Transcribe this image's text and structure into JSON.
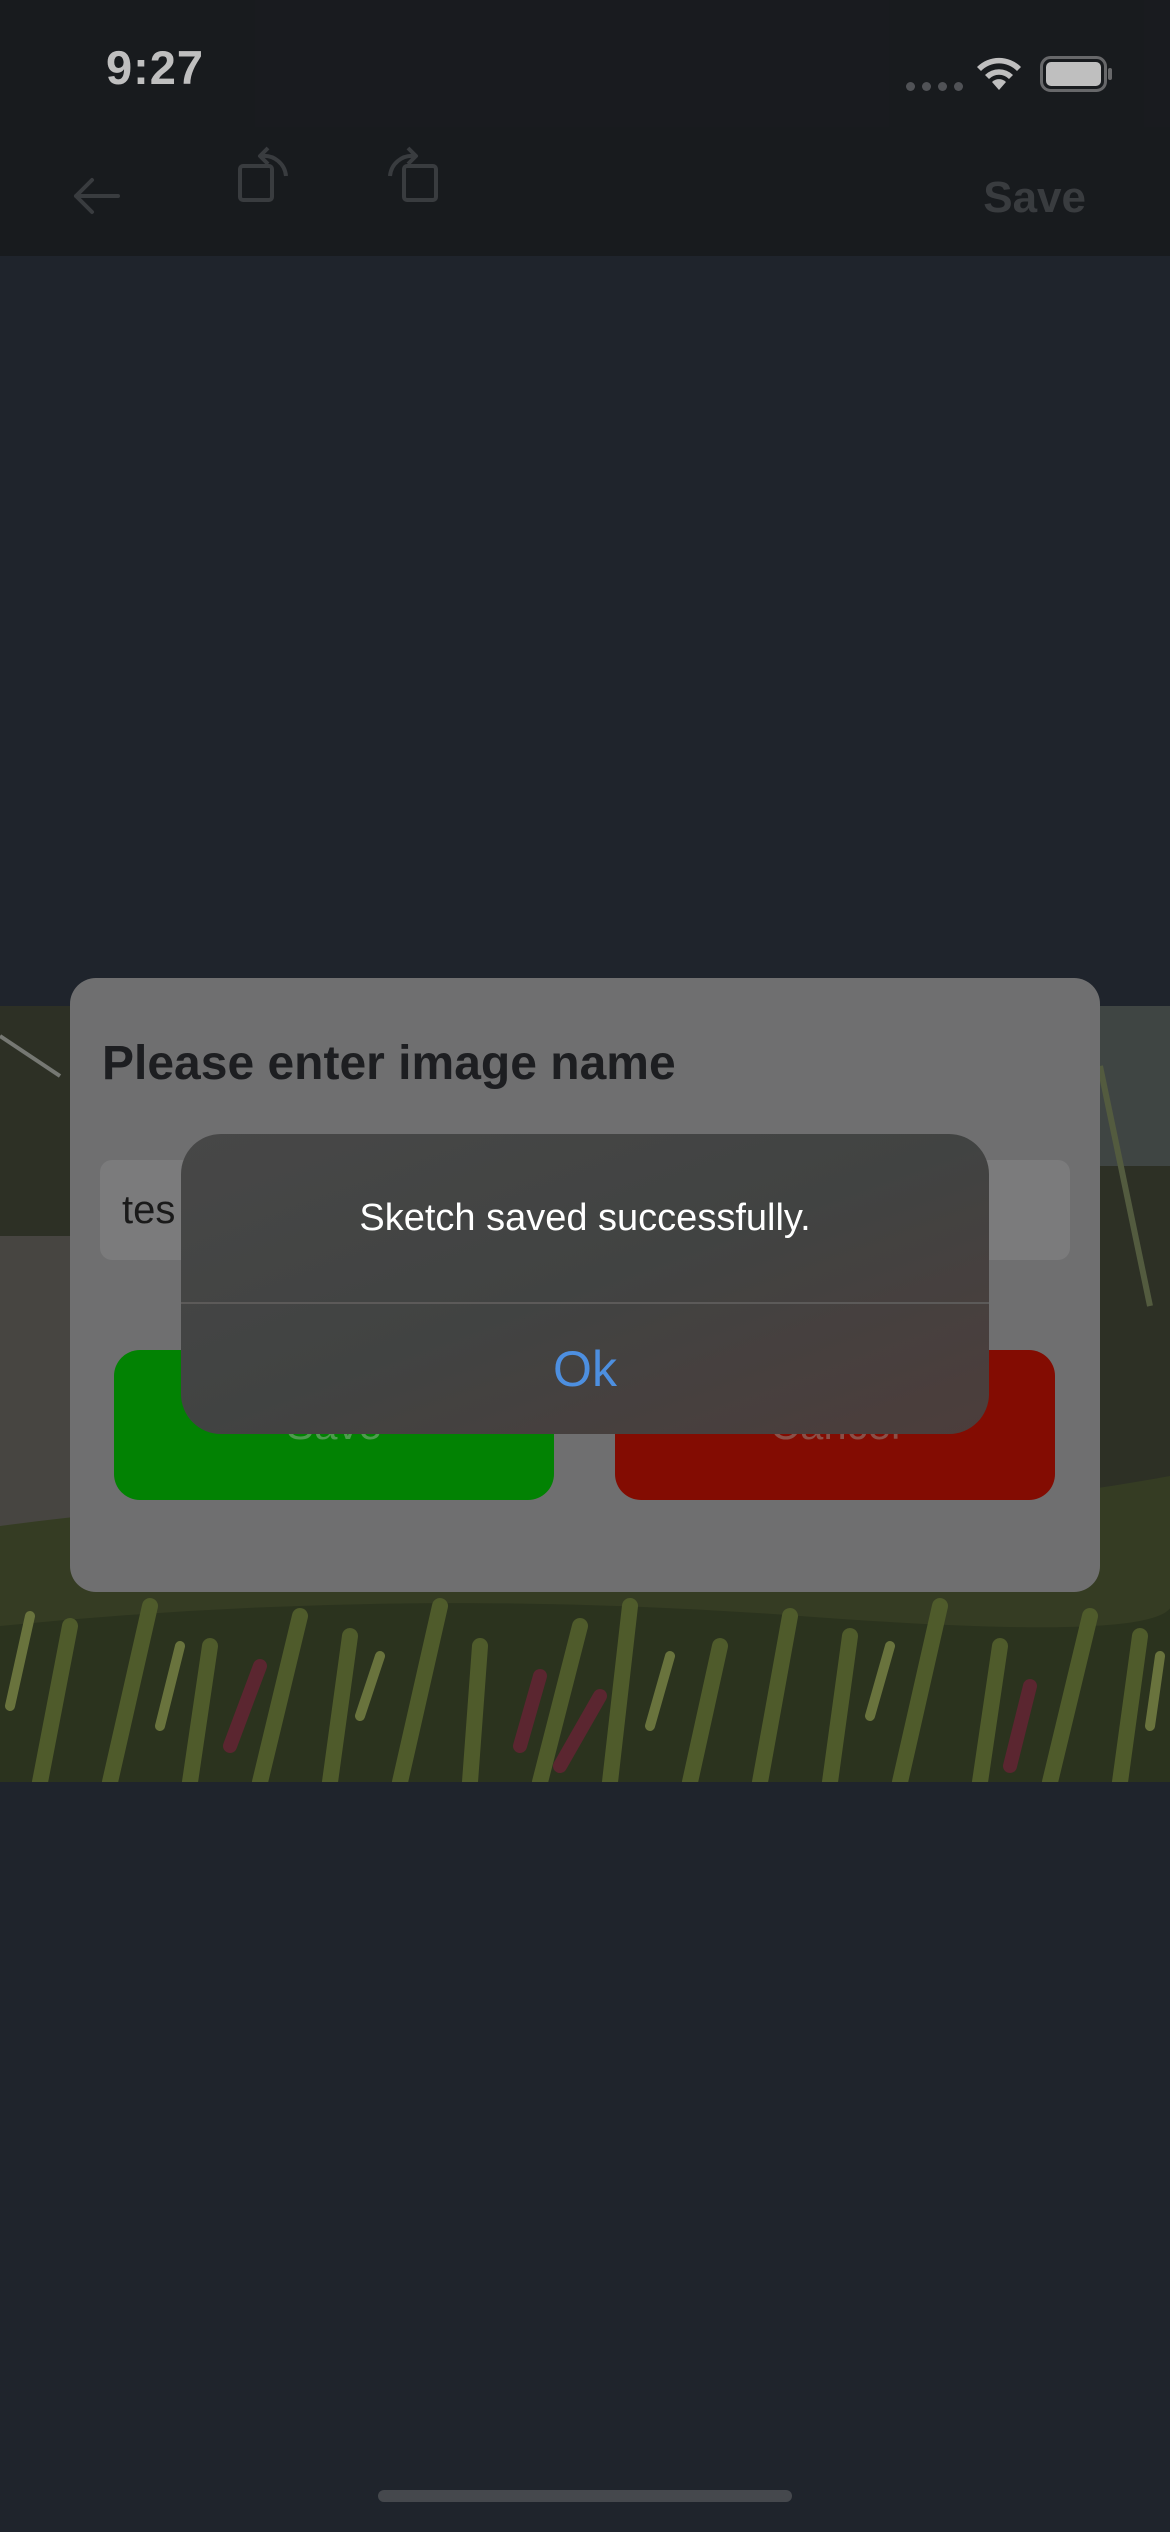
{
  "status_bar": {
    "time": "9:27",
    "icons": [
      "cellular-signal-icon",
      "wifi-icon",
      "battery-icon"
    ]
  },
  "toolbar": {
    "icons": [
      "back-arrow-icon",
      "rotate-left-icon",
      "rotate-right-icon"
    ],
    "save_label": "Save"
  },
  "name_dialog": {
    "title": "Please enter image name",
    "input_value": "tes",
    "save_label": "Save",
    "cancel_label": "Cancel",
    "colors": {
      "save": "#028203",
      "cancel": "#830c02"
    }
  },
  "alert": {
    "message": "Sketch saved successfully.",
    "ok_label": "Ok",
    "accent": "#4d8fe0"
  }
}
